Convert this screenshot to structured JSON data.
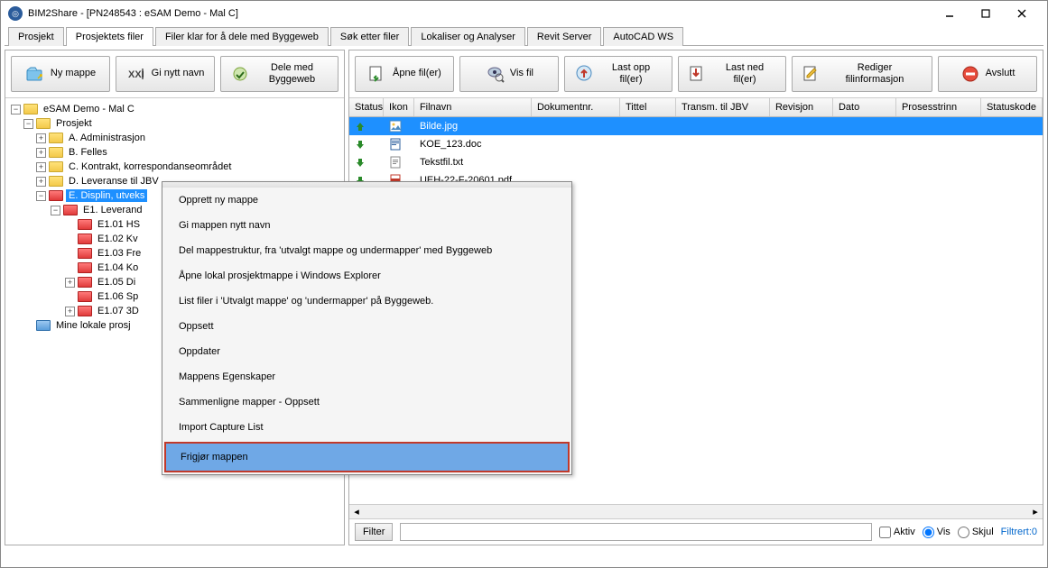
{
  "window": {
    "title": "BIM2Share - [PN248543 : eSAM Demo - Mal C]"
  },
  "tabs": {
    "items": [
      "Prosjekt",
      "Prosjektets filer",
      "Filer klar for å dele med Byggeweb",
      "Søk etter filer",
      "Lokaliser og Analyser",
      "Revit Server",
      "AutoCAD WS"
    ],
    "active_index": 1
  },
  "left_toolbar": {
    "new_folder": "Ny mappe",
    "rename": "Gi nytt navn",
    "share": "Dele med Byggeweb"
  },
  "right_toolbar": {
    "open": "Åpne fil(er)",
    "view": "Vis fil",
    "upload": "Last opp fil(er)",
    "download": "Last ned fil(er)",
    "edit": "Rediger filinformasjon",
    "close": "Avslutt"
  },
  "tree": {
    "root": "eSAM Demo - Mal C",
    "project": "Prosjekt",
    "folders": [
      "A. Administrasjon",
      "B. Felles",
      "C. Kontrakt, korrespondanseområdet",
      "D. Leveranse til JBV",
      "E. Displin, utveks",
      "E1. Leverand",
      "E1.01 HS",
      "E1.02 Kv",
      "E1.03 Fre",
      "E1.04 Ko",
      "E1.05 Di",
      "E1.06 Sp",
      "E1.07 3D"
    ],
    "local": "Mine lokale prosj"
  },
  "grid": {
    "headers": {
      "status": "Status",
      "icon": "Ikon",
      "filename": "Filnavn",
      "doknr": "Dokumentnr.",
      "title": "Tittel",
      "trans": "Transm. til JBV",
      "rev": "Revisjon",
      "date": "Dato",
      "proc": "Prosesstrinn",
      "statuscode": "Statuskode"
    },
    "rows": [
      {
        "filename": "Bilde.jpg",
        "status_icon": "up-green",
        "type_icon": "image",
        "selected": true
      },
      {
        "filename": "KOE_123.doc",
        "status_icon": "down-green",
        "type_icon": "doc",
        "selected": false
      },
      {
        "filename": "Tekstfil.txt",
        "status_icon": "down-green",
        "type_icon": "txt",
        "selected": false
      },
      {
        "filename": "UEH-22-F-20601.pdf",
        "status_icon": "down-green",
        "type_icon": "pdf",
        "selected": false
      }
    ]
  },
  "filter": {
    "label": "Filter",
    "active": "Aktiv",
    "vis": "Vis",
    "skjul": "Skjul",
    "count": "Filtrert:0"
  },
  "context_menu": {
    "items": [
      "Opprett ny mappe",
      "Gi mappen nytt navn",
      "Del mappestruktur, fra 'utvalgt mappe og undermapper' med Byggeweb",
      "Åpne lokal prosjektmappe i Windows Explorer",
      "List filer i 'Utvalgt mappe' og 'undermapper' på Byggeweb.",
      "Oppsett",
      "Oppdater",
      "Mappens Egenskaper",
      "Sammenligne mapper - Oppsett",
      "Import Capture List",
      "Frigjør mappen"
    ],
    "highlighted_index": 10
  }
}
